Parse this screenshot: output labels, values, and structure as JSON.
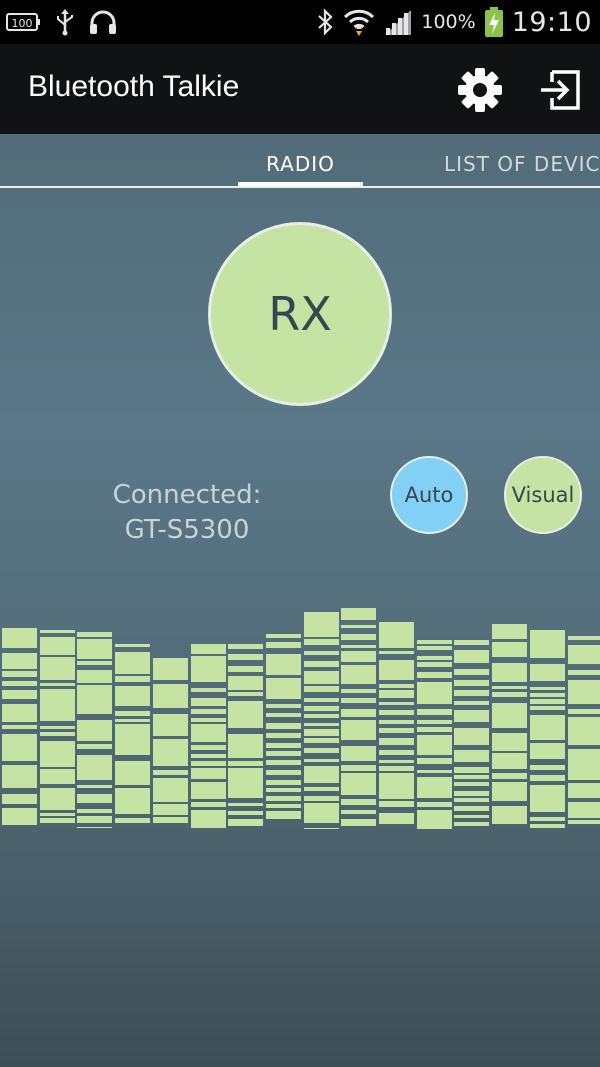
{
  "status_bar": {
    "battery_pct": "100%",
    "time": "19:10",
    "left_icons": [
      "battery-100-icon",
      "usb-icon",
      "headphones-icon"
    ],
    "right_icons": [
      "bluetooth-icon",
      "wifi-icon",
      "signal-icon",
      "battery-charging-icon"
    ]
  },
  "app_bar": {
    "title": "Bluetooth Talkie",
    "actions": [
      "settings-gear-icon",
      "exit-icon"
    ]
  },
  "tabs": [
    {
      "label": "RADIO",
      "selected": true
    },
    {
      "label": "LIST OF DEVIC",
      "selected": false
    }
  ],
  "rx_button": {
    "label": "RX"
  },
  "connection": {
    "line1": "Connected:",
    "line2": "GT-S5300"
  },
  "mode_buttons": {
    "auto": {
      "label": "Auto",
      "color": "#82d0f5"
    },
    "visual": {
      "label": "Visual",
      "color": "#c5e3a2"
    }
  },
  "colors": {
    "accent_green": "#c5e3a2",
    "accent_blue": "#82d0f5",
    "app_bar": "#111213",
    "background_top": "#4e6672"
  }
}
